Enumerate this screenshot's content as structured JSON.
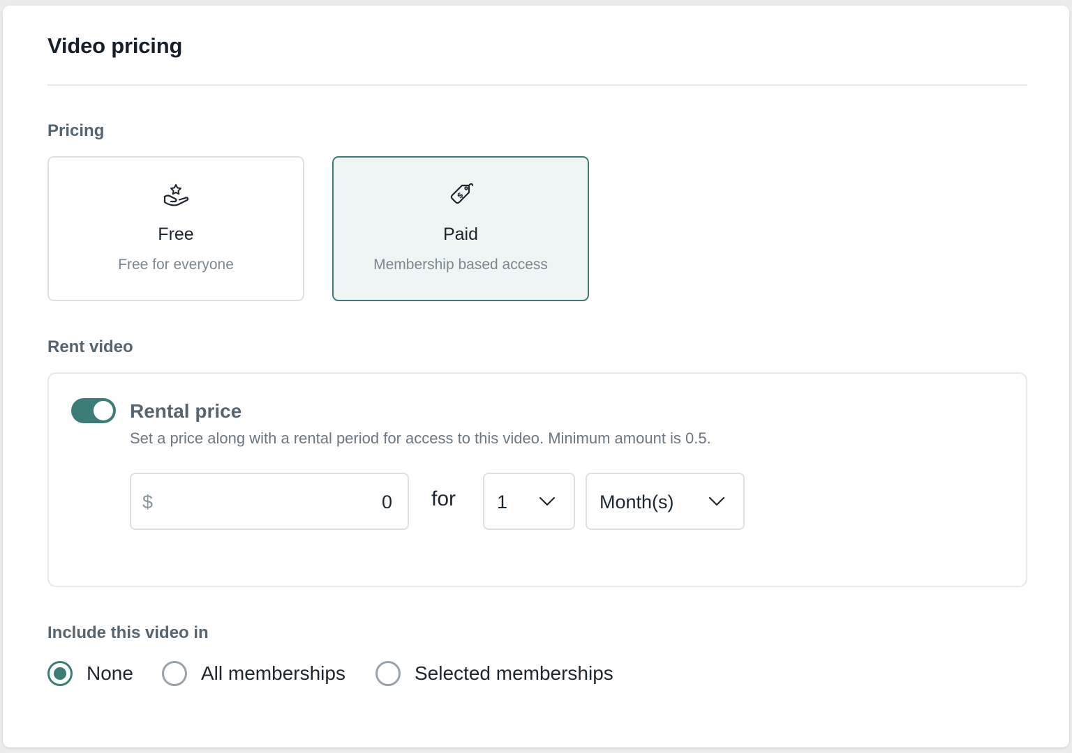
{
  "title": "Video pricing",
  "pricing": {
    "label": "Pricing",
    "options": [
      {
        "title": "Free",
        "subtitle": "Free for everyone",
        "icon": "hand-star-icon",
        "selected": false
      },
      {
        "title": "Paid",
        "subtitle": "Membership based access",
        "icon": "price-tag-dollar-icon",
        "selected": true
      }
    ]
  },
  "rent": {
    "label": "Rent video",
    "toggle_on": true,
    "title": "Rental price",
    "description": "Set a price along with a rental period for access to this video. Minimum amount is 0.5.",
    "currency": "$",
    "price": "0",
    "for_label": "for",
    "period_count": "1",
    "period_unit": "Month(s)"
  },
  "include": {
    "label": "Include this video in",
    "options": [
      {
        "label": "None",
        "checked": true
      },
      {
        "label": "All memberships",
        "checked": false
      },
      {
        "label": "Selected memberships",
        "checked": false
      }
    ]
  },
  "colors": {
    "accent": "#3b7d76",
    "selected_bg": "#eff5f4",
    "border": "#dde1e5"
  }
}
